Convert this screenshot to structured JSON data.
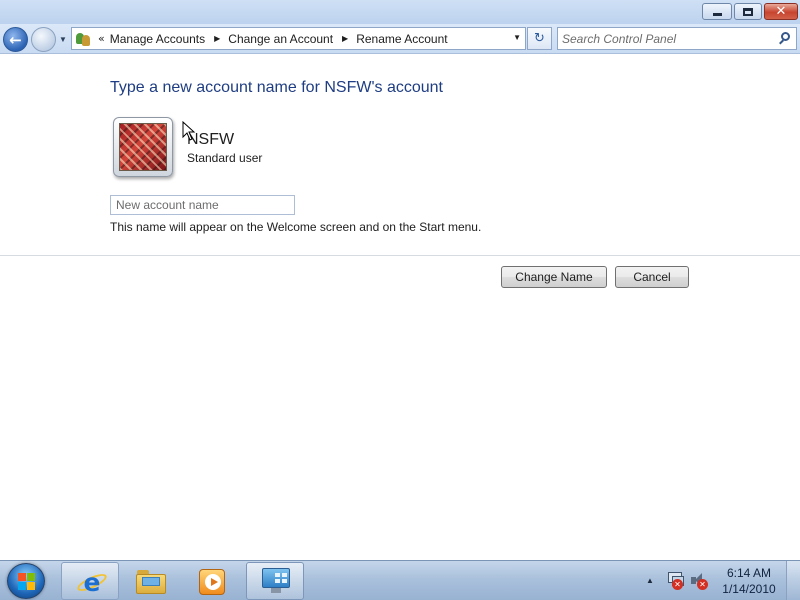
{
  "window": {
    "minimize_icon": "minimize-icon",
    "maximize_icon": "restore-icon",
    "close_glyph": "✕"
  },
  "nav": {
    "back_glyph": "←",
    "address_icon": "user-accounts-icon",
    "overflow": "«",
    "breadcrumbs": [
      "Manage Accounts",
      "Change an Account",
      "Rename Account"
    ],
    "refresh_glyph": "↻",
    "search_placeholder": "Search Control Panel"
  },
  "content": {
    "heading": "Type a new account name for NSFW's account",
    "account_name": "NSFW",
    "account_type": "Standard user",
    "input_placeholder": "New account name",
    "input_value": "",
    "hint": "This name will appear on the Welcome screen and on the Start menu.",
    "change_button": "Change Name",
    "cancel_button": "Cancel"
  },
  "taskbar": {
    "apps": [
      "Internet Explorer",
      "Windows Explorer",
      "Windows Media Player",
      "Control Panel"
    ],
    "tray_icons": [
      "network-disconnected-icon",
      "volume-muted-icon"
    ],
    "time": "6:14 AM",
    "date": "1/14/2010"
  },
  "colors": {
    "heading": "#1f3d82",
    "accent": "#2d63b4"
  }
}
